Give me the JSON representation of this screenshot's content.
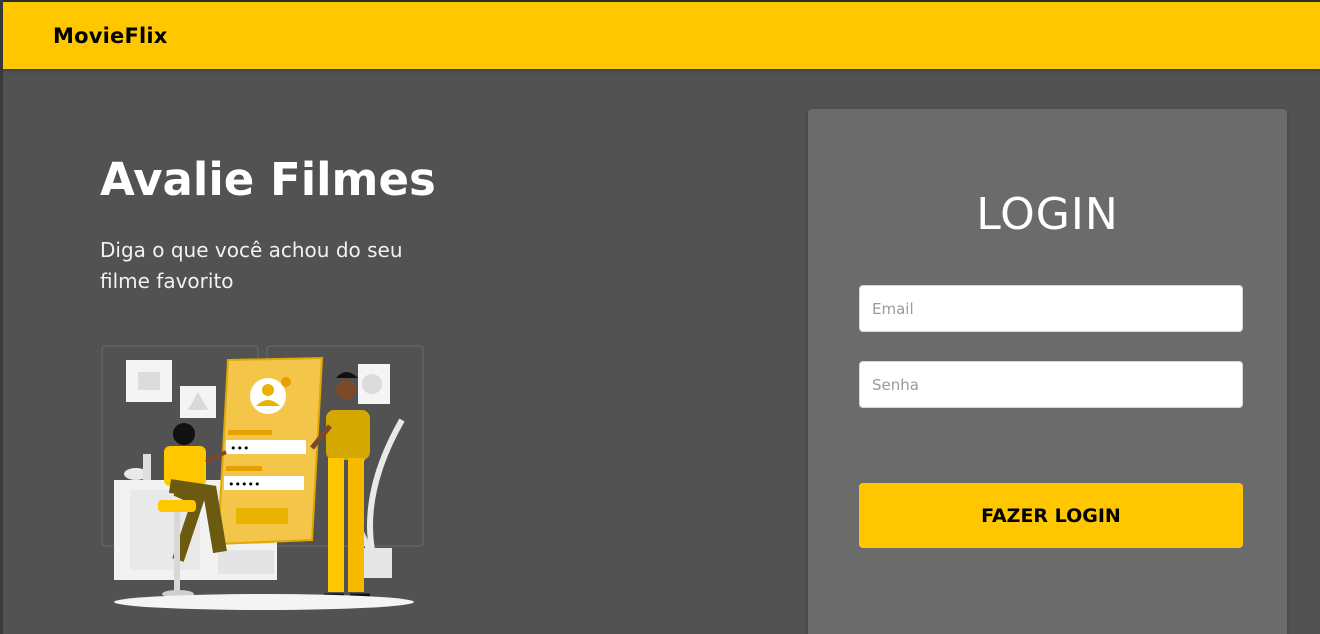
{
  "navbar": {
    "brand": "MovieFlix"
  },
  "hero": {
    "title": "Avalie Filmes",
    "subtitle": "Diga o que você achou do seu filme favorito"
  },
  "illustration": {
    "icon": "login-illustration",
    "password_mask_short": "•••",
    "password_mask_long": "•••••"
  },
  "login": {
    "title": "LOGIN",
    "email_placeholder": "Email",
    "email_value": "",
    "password_placeholder": "Senha",
    "password_value": "",
    "submit_label": "FAZER LOGIN"
  },
  "colors": {
    "accent": "#ffc700",
    "background": "#525252",
    "card": "#6b6b6b"
  }
}
